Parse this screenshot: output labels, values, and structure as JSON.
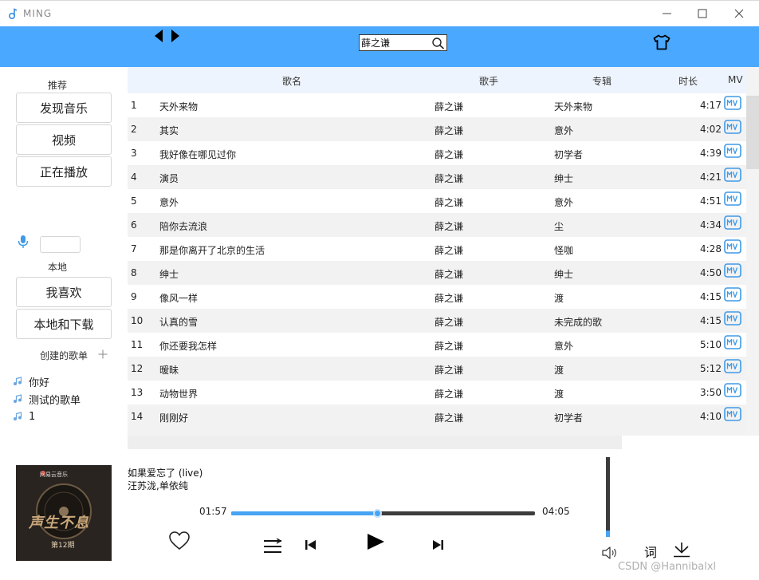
{
  "window": {
    "title": "MING"
  },
  "header": {
    "search": {
      "value": "薛之谦"
    }
  },
  "sidebar": {
    "recommend_label": "推荐",
    "recommend_items": [
      {
        "label": "发现音乐"
      },
      {
        "label": "视频"
      },
      {
        "label": "正在播放"
      }
    ],
    "local_label": "本地",
    "local_items": [
      {
        "label": "我喜欢"
      },
      {
        "label": "本地和下载"
      }
    ],
    "created_playlists_label": "创建的歌单",
    "playlists": [
      {
        "label": "你好"
      },
      {
        "label": "测试的歌单"
      },
      {
        "label": "1"
      }
    ]
  },
  "table": {
    "columns": {
      "title": "歌名",
      "artist": "歌手",
      "album": "专辑",
      "duration": "时长",
      "mv": "MV"
    },
    "rows": [
      {
        "index": "1",
        "title": "天外来物",
        "artist": "薛之谦",
        "album": "天外来物",
        "duration": "4:17"
      },
      {
        "index": "2",
        "title": "其实",
        "artist": "薛之谦",
        "album": "意外",
        "duration": "4:02"
      },
      {
        "index": "3",
        "title": "我好像在哪见过你",
        "artist": "薛之谦",
        "album": "初学者",
        "duration": "4:39"
      },
      {
        "index": "4",
        "title": "演员",
        "artist": "薛之谦",
        "album": "绅士",
        "duration": "4:21"
      },
      {
        "index": "5",
        "title": "意外",
        "artist": "薛之谦",
        "album": "意外",
        "duration": "4:51"
      },
      {
        "index": "6",
        "title": "陪你去流浪",
        "artist": "薛之谦",
        "album": "尘",
        "duration": "4:34"
      },
      {
        "index": "7",
        "title": "那是你离开了北京的生活",
        "artist": "薛之谦",
        "album": "怪咖",
        "duration": "4:28"
      },
      {
        "index": "8",
        "title": "绅士",
        "artist": "薛之谦",
        "album": "绅士",
        "duration": "4:50"
      },
      {
        "index": "9",
        "title": "像风一样",
        "artist": "薛之谦",
        "album": "渡",
        "duration": "4:15"
      },
      {
        "index": "10",
        "title": "认真的雪",
        "artist": "薛之谦",
        "album": "未完成的歌",
        "duration": "4:15"
      },
      {
        "index": "11",
        "title": "你还要我怎样",
        "artist": "薛之谦",
        "album": "意外",
        "duration": "5:10"
      },
      {
        "index": "12",
        "title": "暧昧",
        "artist": "薛之谦",
        "album": "渡",
        "duration": "5:12"
      },
      {
        "index": "13",
        "title": "动物世界",
        "artist": "薛之谦",
        "album": "渡",
        "duration": "3:50"
      },
      {
        "index": "14",
        "title": "刚刚好",
        "artist": "薛之谦",
        "album": "初学者",
        "duration": "4:10"
      }
    ]
  },
  "player": {
    "cover": {
      "badge": "网易云音乐",
      "title": "声生不息",
      "episode": "第12期"
    },
    "song_title": "如果爱忘了 (live)",
    "artists": "汪苏泷,单依纯",
    "current_time": "01:57",
    "total_time": "04:05",
    "progress_fraction": 0.48,
    "volume_fraction": 0.08,
    "lyrics_label": "词"
  },
  "watermark": "CSDN @Hannibalxl",
  "colors": {
    "accent": "#4aa8ff",
    "progress": "#47a3f3",
    "mv_icon": "#3f9ae8"
  }
}
